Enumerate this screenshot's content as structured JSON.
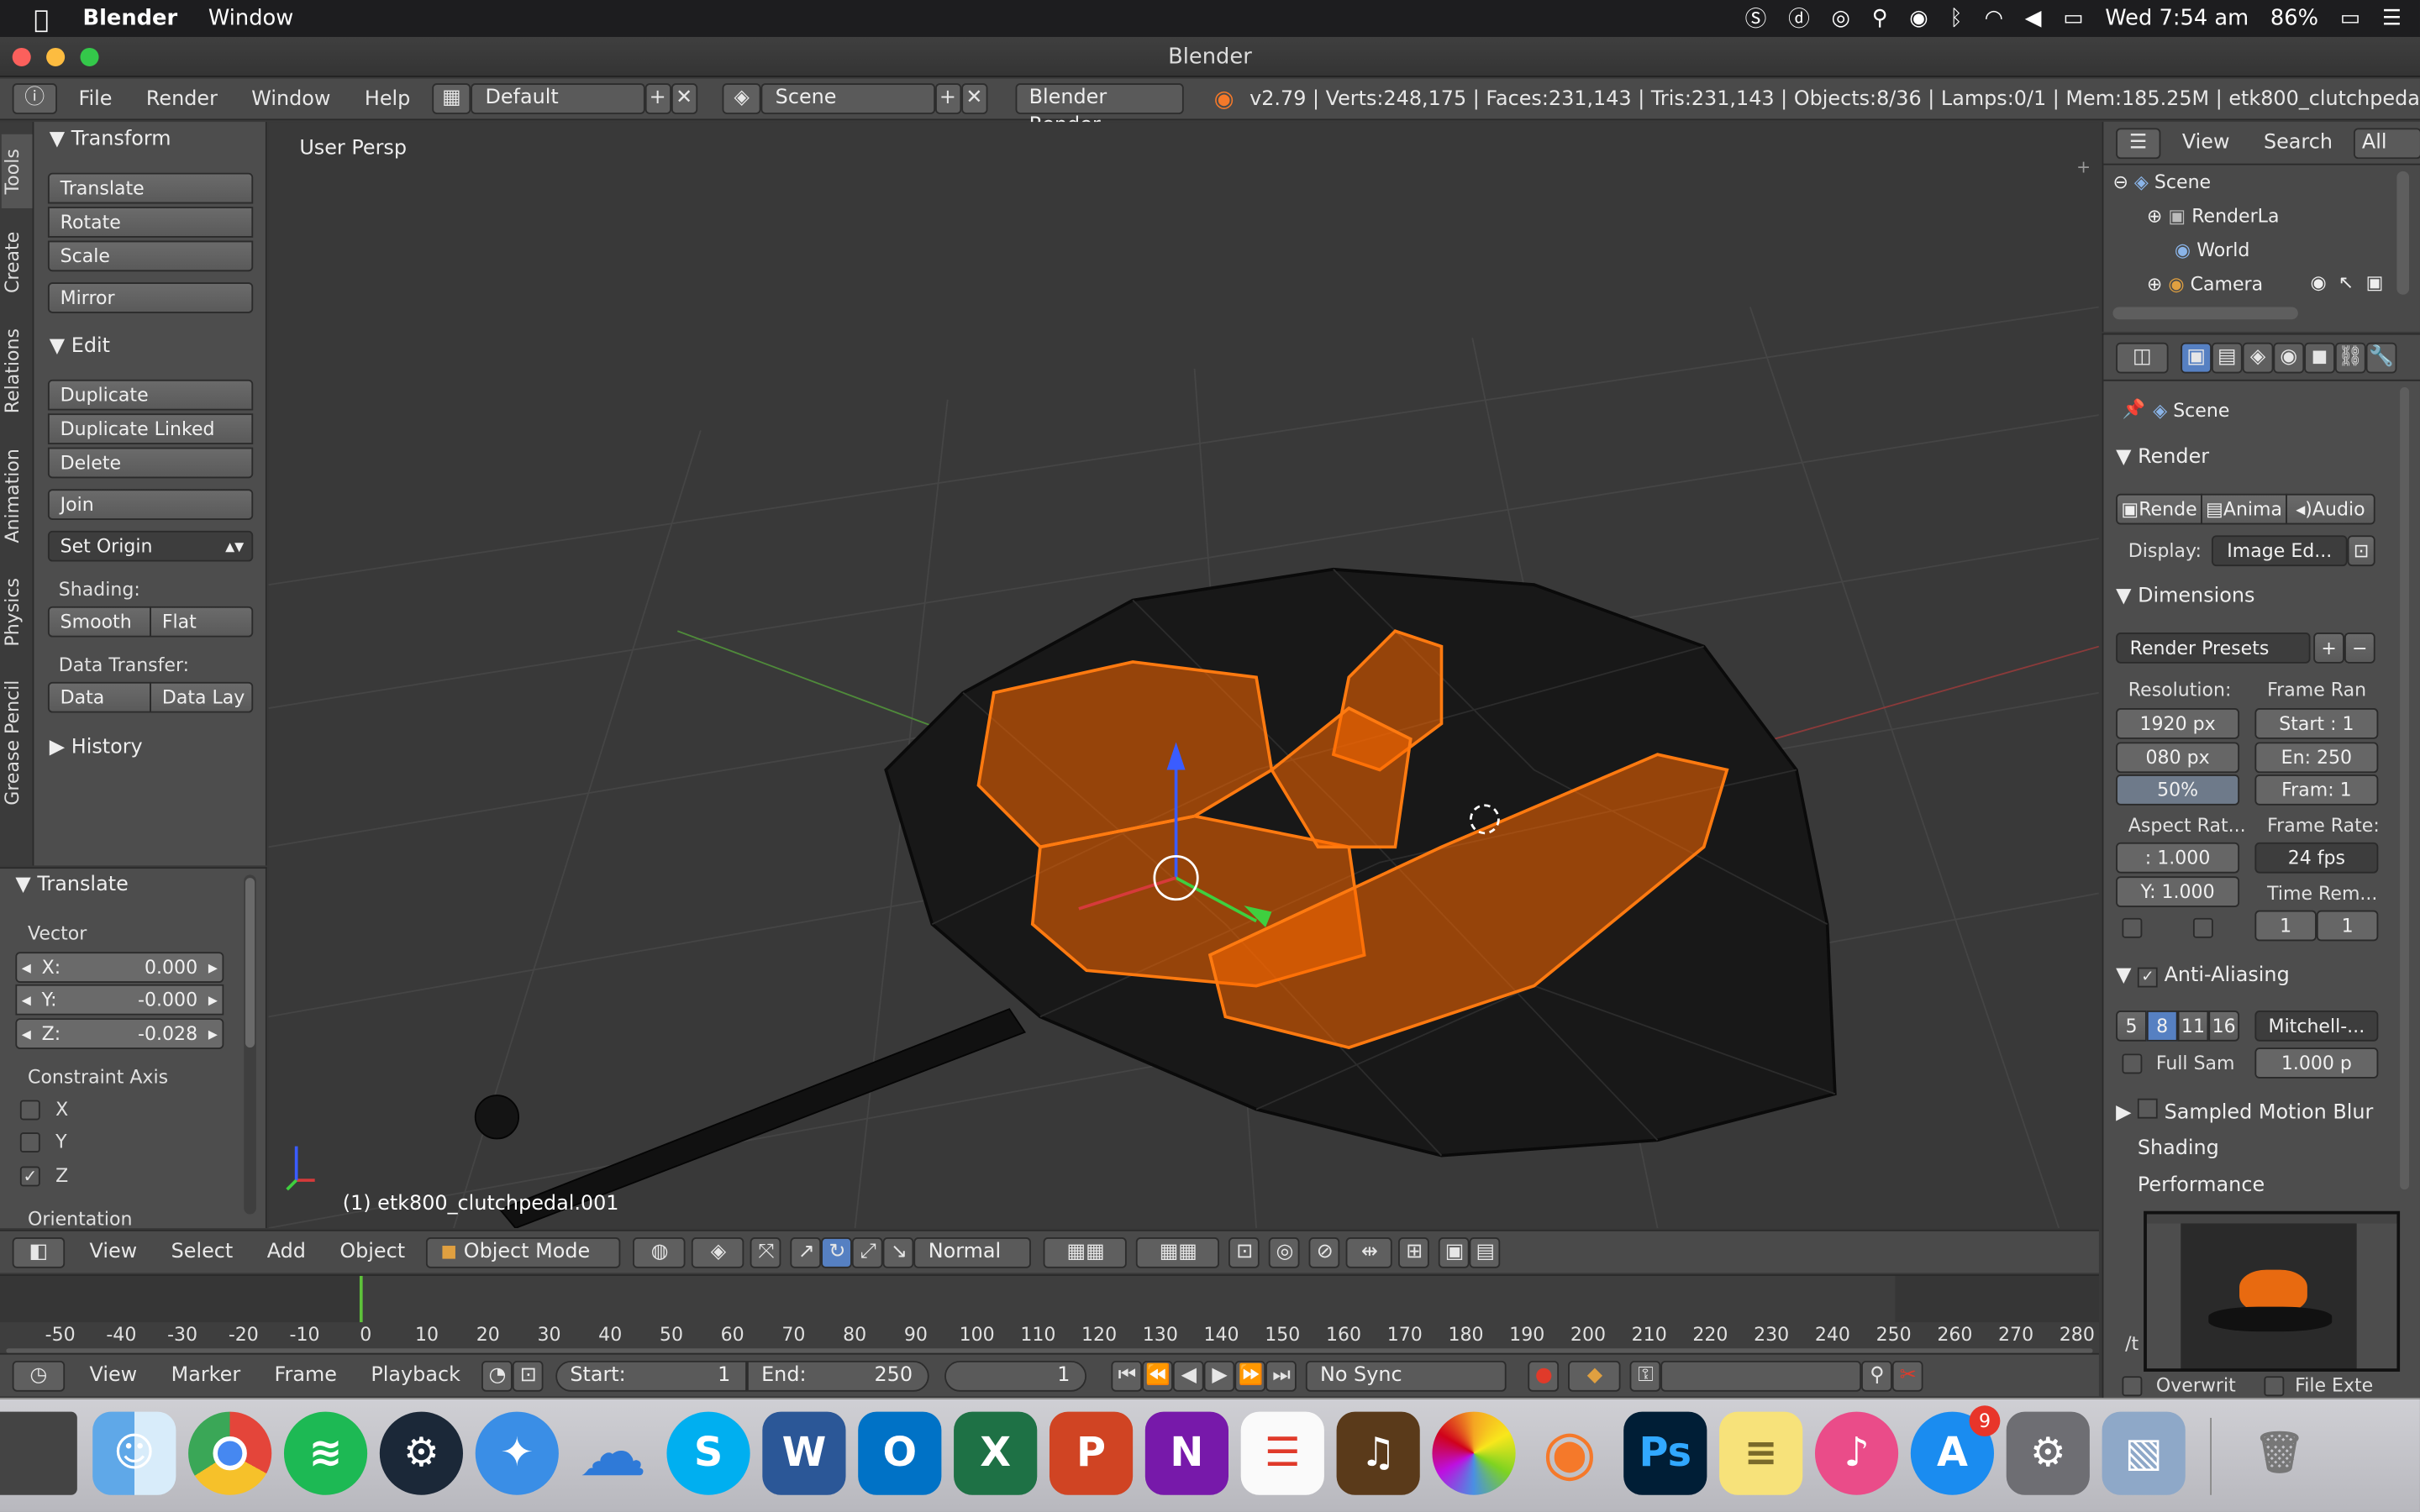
{
  "mac_menubar": {
    "app": "Blender",
    "menu": "Window",
    "clock": "Wed 7:54 am",
    "battery": "86%"
  },
  "window": {
    "title": "Blender"
  },
  "header": {
    "menus": [
      "File",
      "Render",
      "Window",
      "Help"
    ],
    "layout": "Default",
    "scene": "Scene",
    "engine": "Blender Render",
    "stats": "v2.79 | Verts:248,175 | Faces:231,143 | Tris:231,143 | Objects:8/36 | Lamps:0/1 | Mem:185.25M | etk800_clutchpeda"
  },
  "tabs": [
    "Tools",
    "Create",
    "Relations",
    "Animation",
    "Physics",
    "Grease Pencil"
  ],
  "tools": {
    "transform": {
      "title": "Transform",
      "buttons": [
        "Translate",
        "Rotate",
        "Scale",
        "Mirror"
      ]
    },
    "edit": {
      "title": "Edit",
      "buttons": [
        "Duplicate",
        "Duplicate Linked",
        "Delete",
        "Join"
      ],
      "set_origin": "Set Origin"
    },
    "shading": {
      "label": "Shading:",
      "smooth": "Smooth",
      "flat": "Flat"
    },
    "data_transfer": {
      "label": "Data Transfer:",
      "data": "Data",
      "data_lay": "Data Lay"
    },
    "history": "History"
  },
  "operator": {
    "title": "Translate",
    "vector_label": "Vector",
    "x_label": "X:",
    "x": "0.000",
    "y_label": "Y:",
    "y": "-0.000",
    "z_label": "Z:",
    "z": "-0.028",
    "constraint_label": "Constraint Axis",
    "axes": [
      {
        "label": "X",
        "checked": false
      },
      {
        "label": "Y",
        "checked": false
      },
      {
        "label": "Z",
        "checked": true
      }
    ],
    "orientation": "Orientation"
  },
  "viewport": {
    "view_name": "User Persp",
    "object_info": "(1) etk800_clutchpedal.001"
  },
  "view3d_header": {
    "menus": [
      "View",
      "Select",
      "Add",
      "Object"
    ],
    "mode": "Object Mode",
    "orientation": "Normal"
  },
  "timeline": {
    "ticks": [
      "-50",
      "-40",
      "-30",
      "-20",
      "-10",
      "0",
      "10",
      "20",
      "30",
      "40",
      "50",
      "60",
      "70",
      "80",
      "90",
      "100",
      "110",
      "120",
      "130",
      "140",
      "150",
      "160",
      "170",
      "180",
      "190",
      "200",
      "210",
      "220",
      "230",
      "240",
      "250",
      "260",
      "270",
      "280"
    ],
    "menus": [
      "View",
      "Marker",
      "Frame",
      "Playback"
    ],
    "start_label": "Start:",
    "start": "1",
    "end_label": "End:",
    "end": "250",
    "current": "1",
    "sync": "No Sync"
  },
  "outliner": {
    "menus": [
      "View",
      "Search"
    ],
    "filter": "All Sce",
    "items": [
      "Scene",
      "RenderLa",
      "World",
      "Camera"
    ]
  },
  "properties": {
    "context": "Scene",
    "render": {
      "title": "Render",
      "render_btn": "Rende",
      "anim_btn": "Anima",
      "audio_btn": "Audio",
      "display_label": "Display:",
      "display": "Image Ed..."
    },
    "dimensions": {
      "title": "Dimensions",
      "presets": "Render Presets",
      "resolution_label": "Resolution:",
      "res_x": "1920 px",
      "res_y": "080 px",
      "res_pct": "50%",
      "frame_range_label": "Frame Ran",
      "start": "Start : 1",
      "end": "En: 250",
      "step": "Fram: 1",
      "aspect_label": "Aspect Rat...",
      "aspect_x": ":  1.000",
      "aspect_y": "Y: 1.000",
      "frame_rate_label": "Frame Rate:",
      "fps": "24 fps",
      "time_remap_label": "Time Rem...",
      "remap_old": "1",
      "remap_new": "1"
    },
    "anti_aliasing": {
      "title": "Anti-Aliasing",
      "samples": [
        "5",
        "8",
        "11",
        "16"
      ],
      "filter": "Mitchell-...",
      "full_sample": "Full Sam",
      "size": "1.000 p"
    },
    "sampled_motion_blur": "Sampled Motion Blur",
    "shading": "Shading",
    "performance": "Performance",
    "output_path": "/t",
    "overwrite": "Overwrit",
    "file_ext": "File Exte"
  },
  "dock": {
    "appstore_badge": "9"
  }
}
